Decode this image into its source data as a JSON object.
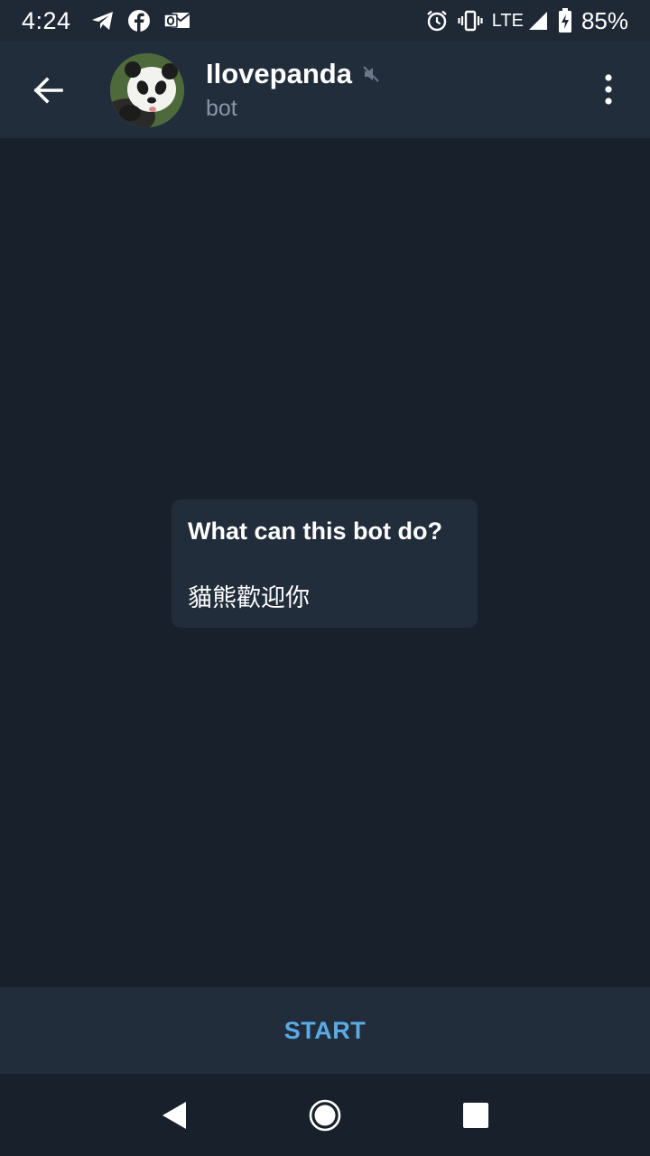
{
  "status_bar": {
    "time": "4:24",
    "notification_icons": [
      "telegram-icon",
      "facebook-icon",
      "outlook-icon"
    ],
    "system_icons": [
      "alarm-icon",
      "vibrate-icon",
      "signal-icon",
      "battery-charging-icon"
    ],
    "network": "LTE",
    "battery": "85%"
  },
  "header": {
    "title": "Ilovepanda",
    "subtitle": "bot",
    "muted": true
  },
  "bot_info": {
    "title": "What can this bot do?",
    "description": "貓熊歡迎你"
  },
  "start_bar": {
    "label": "START"
  },
  "colors": {
    "background": "#18202b",
    "header": "#222d3c",
    "accent": "#5caae3",
    "subtitle": "#8a96a5"
  }
}
